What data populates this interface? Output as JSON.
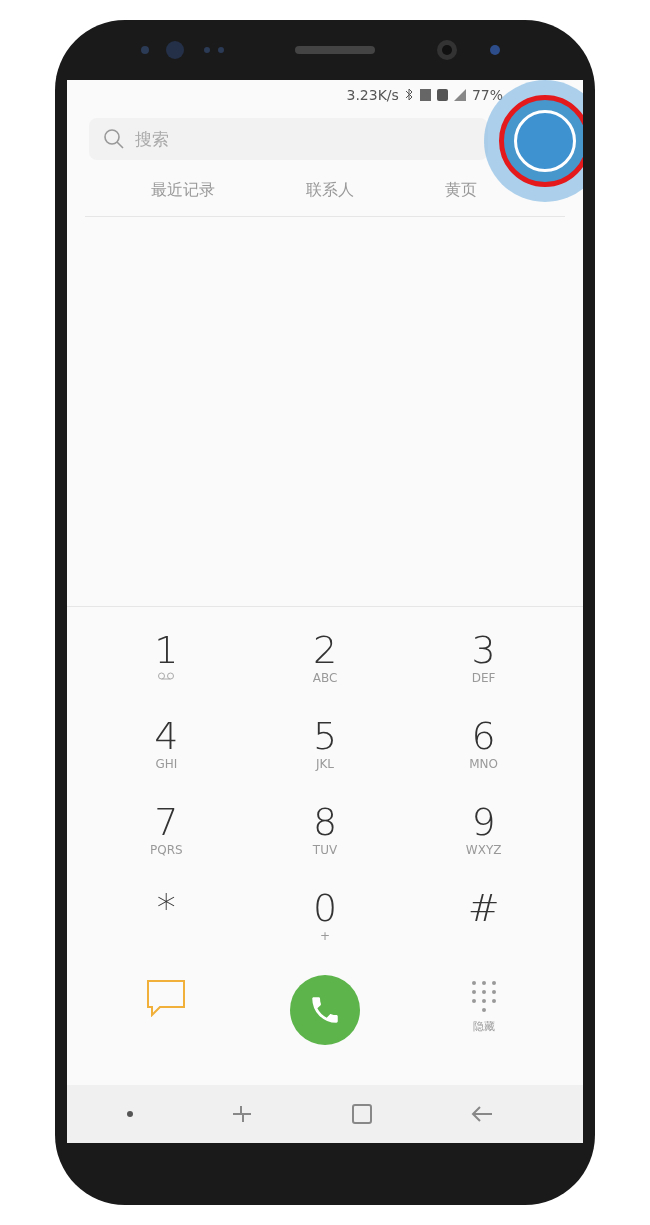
{
  "status_bar": {
    "speed": "3.23K/s",
    "battery": "77%"
  },
  "search": {
    "placeholder": "搜索"
  },
  "tabs": [
    {
      "label": "最近记录",
      "selected": false
    },
    {
      "label": "联系人",
      "selected": false
    },
    {
      "label": "黄页",
      "selected": false
    }
  ],
  "keypad": [
    {
      "digit": "1",
      "kind": "voicemail"
    },
    {
      "digit": "2",
      "kind": "letters",
      "letters": "ABC"
    },
    {
      "digit": "3",
      "kind": "letters",
      "letters": "DEF"
    },
    {
      "digit": "4",
      "kind": "letters",
      "letters": "GHI"
    },
    {
      "digit": "5",
      "kind": "letters",
      "letters": "JKL"
    },
    {
      "digit": "6",
      "kind": "letters",
      "letters": "MNO"
    },
    {
      "digit": "7",
      "kind": "letters",
      "letters": "PQRS"
    },
    {
      "digit": "8",
      "kind": "letters",
      "letters": "TUV"
    },
    {
      "digit": "9",
      "kind": "letters",
      "letters": "WXYZ"
    },
    {
      "digit": "*",
      "kind": "symbol"
    },
    {
      "digit": "0",
      "kind": "letters",
      "letters": "+"
    },
    {
      "digit": "#",
      "kind": "symbol"
    }
  ],
  "hide_keypad": {
    "label": "隐藏"
  }
}
